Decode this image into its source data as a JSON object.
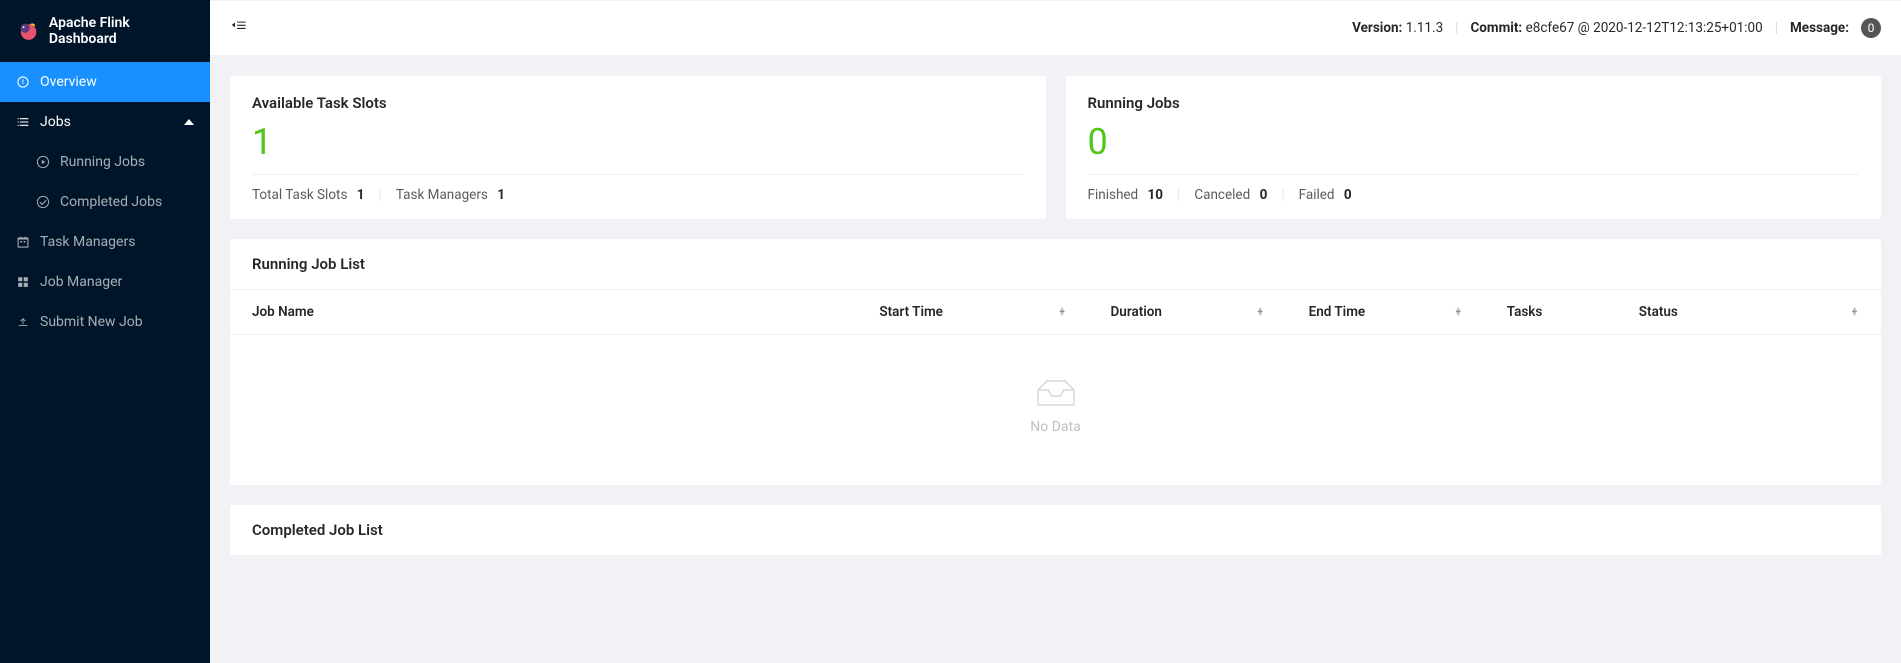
{
  "brand": {
    "title": "Apache Flink Dashboard"
  },
  "sidebar": {
    "overview": "Overview",
    "jobs_group": "Jobs",
    "running_jobs": "Running Jobs",
    "completed_jobs": "Completed Jobs",
    "task_managers": "Task Managers",
    "job_manager": "Job Manager",
    "submit_new_job": "Submit New Job"
  },
  "header": {
    "version_label": "Version:",
    "version_value": "1.11.3",
    "commit_label": "Commit:",
    "commit_hash": "e8cfe67",
    "commit_ts": "@ 2020-12-12T12:13:25+01:00",
    "message_label": "Message:",
    "message_count": "0"
  },
  "cards": {
    "slots": {
      "title": "Available Task Slots",
      "value": "1",
      "total_label": "Total Task Slots",
      "total_value": "1",
      "managers_label": "Task Managers",
      "managers_value": "1"
    },
    "running": {
      "title": "Running Jobs",
      "value": "0",
      "finished_label": "Finished",
      "finished_value": "10",
      "canceled_label": "Canceled",
      "canceled_value": "0",
      "failed_label": "Failed",
      "failed_value": "0"
    }
  },
  "tables": {
    "running_title": "Running Job List",
    "completed_title": "Completed Job List",
    "columns": {
      "job_name": "Job Name",
      "start_time": "Start Time",
      "duration": "Duration",
      "end_time": "End Time",
      "tasks": "Tasks",
      "status": "Status"
    },
    "empty_text": "No Data"
  }
}
